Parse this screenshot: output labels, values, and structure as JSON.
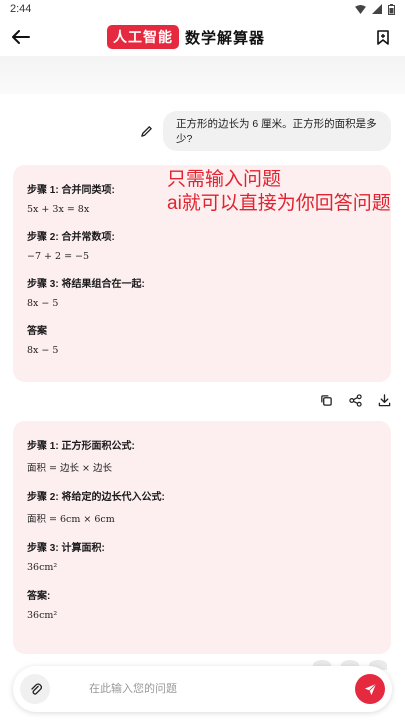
{
  "status_bar": {
    "time": "2:44"
  },
  "header": {
    "badge": "人工智能",
    "title": "数学解算器"
  },
  "user_message": "正方形的边长为 6 厘米。正方形的面积是多少?",
  "overlay": {
    "line1": "只需输入问题",
    "line2": "ai就可以直接为你回答问题"
  },
  "answer1": {
    "steps": [
      {
        "title": "步骤 1: 合并同类项:",
        "eq": "5x + 3x = 8x"
      },
      {
        "title": "步骤 2: 合并常数项:",
        "eq": "−7 + 2 = −5"
      },
      {
        "title": "步骤 3: 将结果组合在一起:",
        "eq": "8x − 5"
      },
      {
        "title": "答案",
        "eq": "8x − 5"
      }
    ]
  },
  "answer2": {
    "steps": [
      {
        "title": "步骤 1: 正方形面积公式:",
        "eq": "面积 = 边长 × 边长"
      },
      {
        "title": "步骤 2: 将给定的边长代入公式:",
        "eq": "面积 = 6cm × 6cm"
      },
      {
        "title": "步骤 3: 计算面积:",
        "eq": "36cm²"
      },
      {
        "title": "答案:",
        "eq": "36cm²"
      }
    ]
  },
  "input": {
    "placeholder": "在此输入您的问题"
  },
  "colors": {
    "accent": "#e52a3f",
    "card_bg": "#fdeef0",
    "overlay_text": "#e0242f"
  },
  "icons": {
    "back": "arrow-left-icon",
    "bookmark": "bookmark-icon",
    "edit": "pencil-icon",
    "copy": "copy-icon",
    "share": "share-icon",
    "download": "download-icon",
    "attach": "paperclip-icon",
    "send": "send-icon"
  }
}
